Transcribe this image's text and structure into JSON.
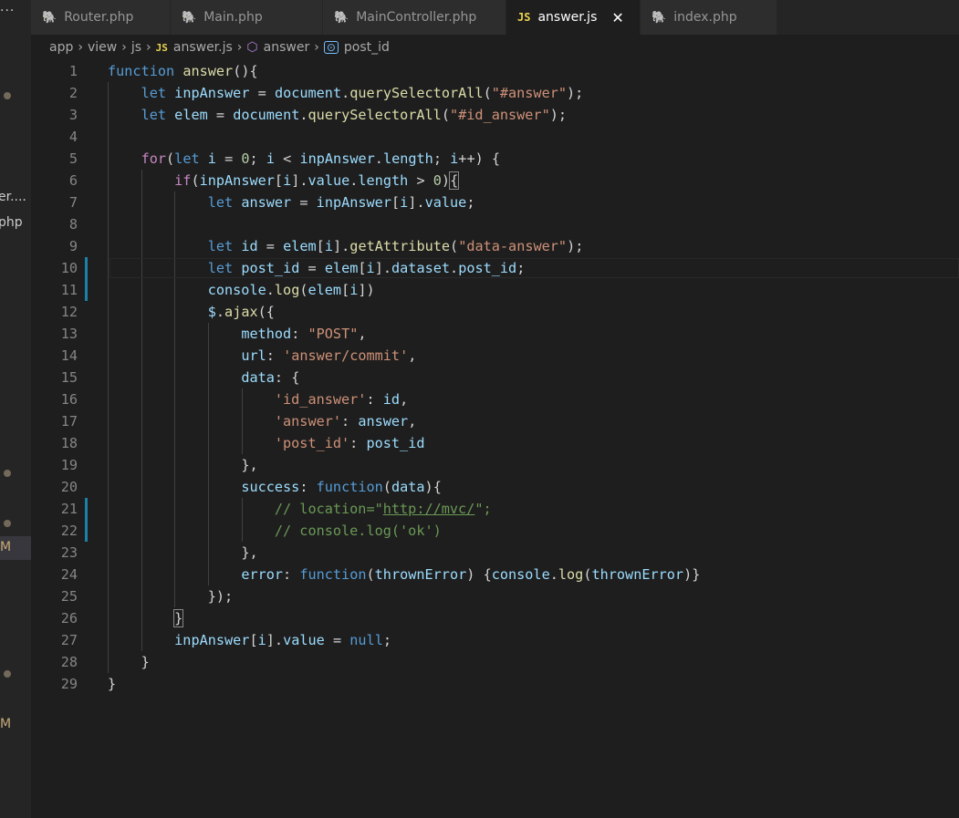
{
  "sidebar": {
    "menu_dots": "···",
    "truncated_items": [
      "er....",
      "php"
    ],
    "badges": [
      "M",
      "M"
    ]
  },
  "tabs": [
    {
      "label": "Router.php",
      "icon": "php-elephant-icon",
      "active": false
    },
    {
      "label": "Main.php",
      "icon": "php-elephant-icon",
      "active": false
    },
    {
      "label": "MainController.php",
      "icon": "php-elephant-icon",
      "active": false
    },
    {
      "label": "answer.js",
      "icon": "js-file-icon",
      "icon_text": "JS",
      "active": true,
      "close": "✕"
    },
    {
      "label": "index.php",
      "icon": "php-elephant-icon",
      "active": false
    }
  ],
  "breadcrumb": {
    "parts": [
      "app",
      "view",
      "js"
    ],
    "file": "answer.js",
    "file_icon_text": "JS",
    "symbol": "answer",
    "property": "post_id",
    "separator": "›"
  },
  "editor": {
    "language": "javascript",
    "current_line": 10,
    "modified_lines": [
      10,
      11,
      21,
      22
    ],
    "line_numbers": [
      "1",
      "2",
      "3",
      "4",
      "5",
      "6",
      "7",
      "8",
      "9",
      "10",
      "11",
      "12",
      "13",
      "14",
      "15",
      "16",
      "17",
      "18",
      "19",
      "20",
      "21",
      "22",
      "23",
      "24",
      "25",
      "26",
      "27",
      "28",
      "29"
    ],
    "lines": [
      "function answer(){",
      "    let inpAnswer = document.querySelectorAll(\"#answer\");",
      "    let elem = document.querySelectorAll(\"#id_answer\");",
      "",
      "    for(let i = 0; i < inpAnswer.length; i++) {",
      "        if(inpAnswer[i].value.length > 0){",
      "            let answer = inpAnswer[i].value;",
      "",
      "            let id = elem[i].getAttribute(\"data-answer\");",
      "            let post_id = elem[i].dataset.post_id;",
      "            console.log(elem[i])",
      "            $.ajax({",
      "                method: \"POST\",",
      "                url: 'answer/commit',",
      "                data: {",
      "                    'id_answer': id,",
      "                    'answer': answer,",
      "                    'post_id': post_id",
      "                },",
      "                success: function(data){",
      "                    // location=\"http://mvc/\";",
      "                    // console.log('ok')",
      "                },",
      "                error: function(thrownError) {console.log(thrownError)}",
      "            });",
      "        }",
      "        inpAnswer[i].value = null;",
      "    }",
      "}"
    ]
  }
}
